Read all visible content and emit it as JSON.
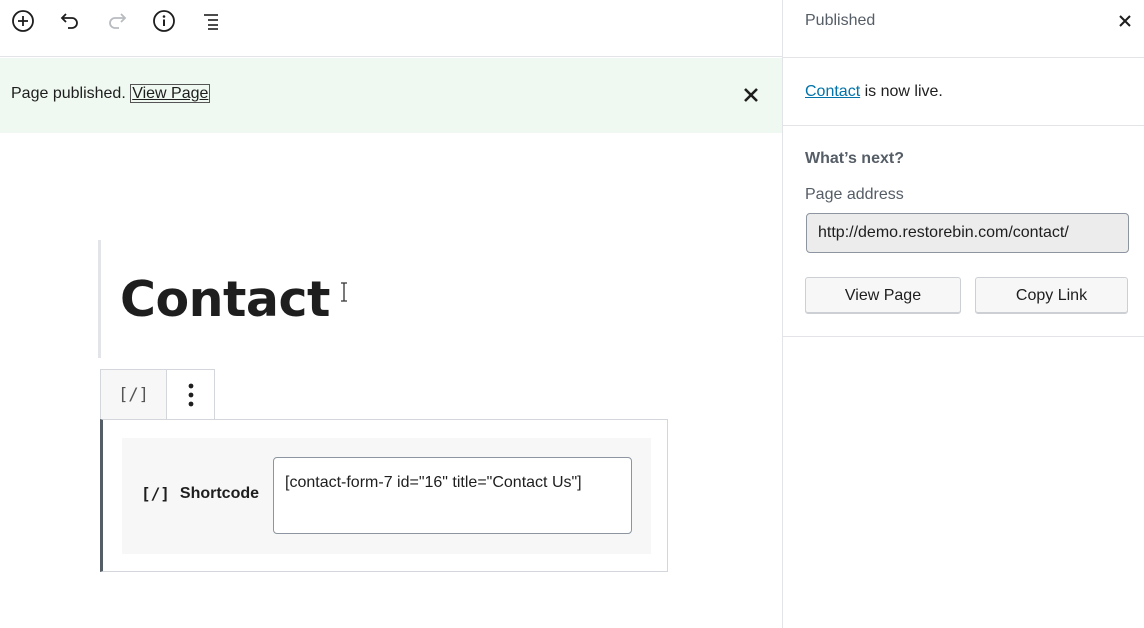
{
  "toolbar": {
    "buttons": [
      {
        "icon": "add-block-icon"
      },
      {
        "icon": "undo-icon"
      },
      {
        "icon": "redo-icon"
      },
      {
        "icon": "info-icon"
      },
      {
        "icon": "outline-icon"
      }
    ]
  },
  "notice": {
    "text": "Page published. ",
    "link_label": "View Page"
  },
  "editor": {
    "title": "Contact",
    "block_type_icon": "[/]",
    "shortcode": {
      "icon": "[/]",
      "label": "Shortcode",
      "value": "[contact-form-7 id=\"16\" title=\"Contact Us\"]"
    }
  },
  "sidebar": {
    "title": "Published",
    "live_link": "Contact",
    "live_suffix": " is now live.",
    "next_heading": "What’s next?",
    "address_label": "Page address",
    "address_value": "http://demo.restorebin.com/contact/",
    "view_button": "View Page",
    "copy_button": "Copy Link"
  },
  "colors": {
    "notice_bg": "#eff9f1",
    "link": "#0073aa",
    "text": "#1e1e1e",
    "muted": "#555d66"
  }
}
